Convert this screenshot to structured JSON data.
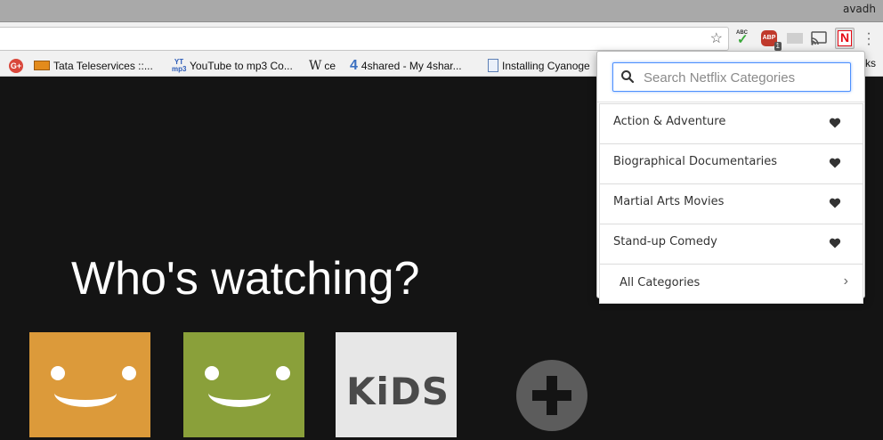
{
  "browser": {
    "user_name": "avadh",
    "abp_badge": "1",
    "abp_text": "ABP",
    "abc_text": "ABC",
    "netflix_ext_letter": "N",
    "bookmarks": [
      {
        "label": "",
        "icon": "google-plus-icon"
      },
      {
        "label": "Tata Teleservices ::...",
        "icon": "tata-icon"
      },
      {
        "label": "YouTube to mp3 Co...",
        "icon": "yt-mp3-icon",
        "icon_text": "YT\nmp3"
      },
      {
        "label": "ce",
        "icon": "wikipedia-icon",
        "icon_text": "W"
      },
      {
        "label": "4shared - My 4shar...",
        "icon": "4shared-icon",
        "icon_text": "4"
      },
      {
        "label": "Installing Cyanoge",
        "icon": "doc-icon"
      }
    ],
    "bookmarks_overflow": "ks"
  },
  "page": {
    "heading": "Who's watching?",
    "kids_label": "KiDS"
  },
  "popup": {
    "search_placeholder": "Search Netflix Categories",
    "categories": [
      {
        "label": "Action & Adventure"
      },
      {
        "label": "Biographical Documentaries"
      },
      {
        "label": "Martial Arts Movies"
      },
      {
        "label": "Stand-up Comedy"
      }
    ],
    "all_categories_label": "All Categories"
  },
  "colors": {
    "netflix_red": "#e50914",
    "page_bg": "#141414",
    "profile_orange": "#dc9a3a",
    "profile_green": "#8aa03a",
    "focus_blue": "#4d90fe"
  }
}
